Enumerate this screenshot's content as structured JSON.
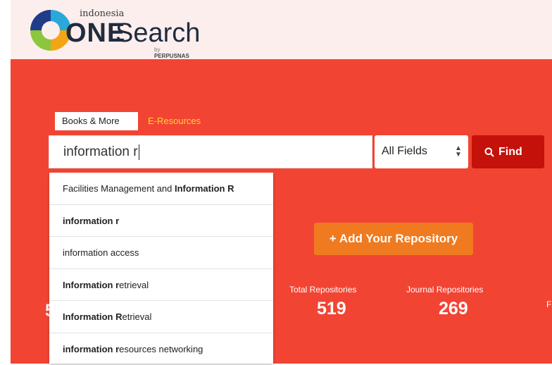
{
  "logo": {
    "small_text": "indonesia",
    "one": "ONE",
    "search": "Search",
    "by": "by",
    "by_brand": "PERPUSNAS"
  },
  "tabs": [
    {
      "label": "Books & More",
      "active": true
    },
    {
      "label": "E-Resources",
      "active": false
    }
  ],
  "search": {
    "value": "information r"
  },
  "field_select": {
    "selected": "All Fields"
  },
  "find_button": {
    "label": "Find"
  },
  "suggestions": [
    {
      "plain": "Facilities Management and ",
      "bold": "Information R",
      "bold_first": false
    },
    {
      "plain": "",
      "bold": "information r",
      "bold_first": true
    },
    {
      "plain": "information access",
      "bold": "",
      "bold_first": true
    },
    {
      "bold": "Information ",
      "plain_mid": "r",
      "bold2": "",
      "rest": "etrieval",
      "type": "split"
    },
    {
      "bold": "Information R",
      "rest": "etrieval",
      "type": "split2"
    },
    {
      "bold": "information r",
      "rest": "esources networking",
      "type": "split2"
    }
  ],
  "add_repo_button": {
    "label": "+ Add Your Repository"
  },
  "stats": [
    {
      "label": "Total Repositories",
      "value": "519"
    },
    {
      "label": "Journal Repositories",
      "value": "269"
    }
  ],
  "partial": {
    "left_value": "5",
    "right_label": "F"
  },
  "colors": {
    "hero": "#f24433",
    "find_button": "#c4110a",
    "add_button": "#f07a1f",
    "eresources_tab": "#ffd23a",
    "header": "#fdeeee"
  }
}
